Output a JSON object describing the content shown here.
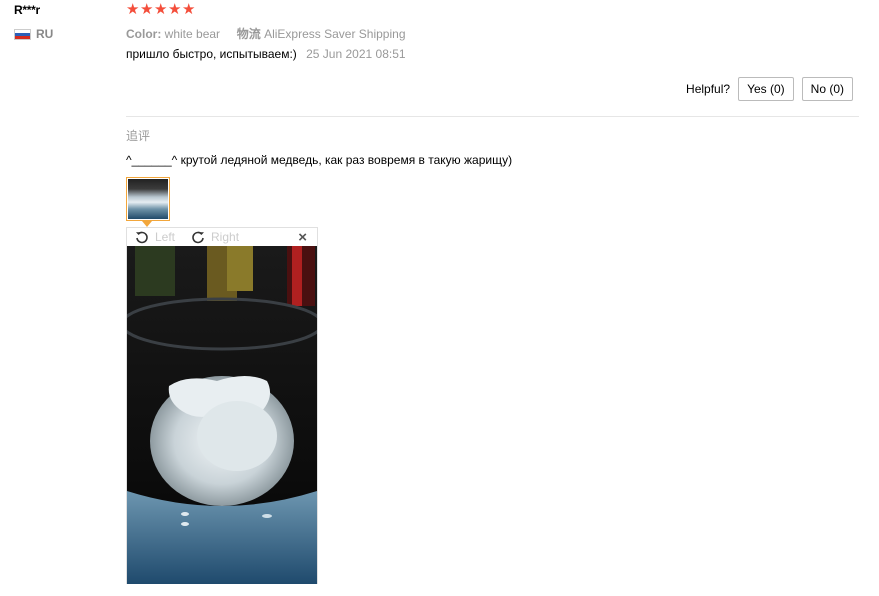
{
  "user": {
    "name": "R***r",
    "country": "RU"
  },
  "rating": {
    "stars": 5,
    "max": 5,
    "color": "#f44e3b"
  },
  "attributes": {
    "color_key": "Color:",
    "color_value": "white bear",
    "shipping_key": "物流",
    "shipping_value": "AliExpress Saver Shipping"
  },
  "review": {
    "text": "пришло быстро, испытываем:)",
    "date": "25 Jun 2021 08:51"
  },
  "helpful": {
    "label": "Helpful?",
    "yes": "Yes (0)",
    "no": "No (0)"
  },
  "additional": {
    "title": "追评",
    "text": "^______^ крутой ледяной медведь, как раз вовремя в такую жарищу)"
  },
  "viewer": {
    "rotate_left": "Left",
    "rotate_right": "Right",
    "close": "×"
  },
  "colors": {
    "accent": "#f2a63b",
    "muted": "#999999"
  }
}
